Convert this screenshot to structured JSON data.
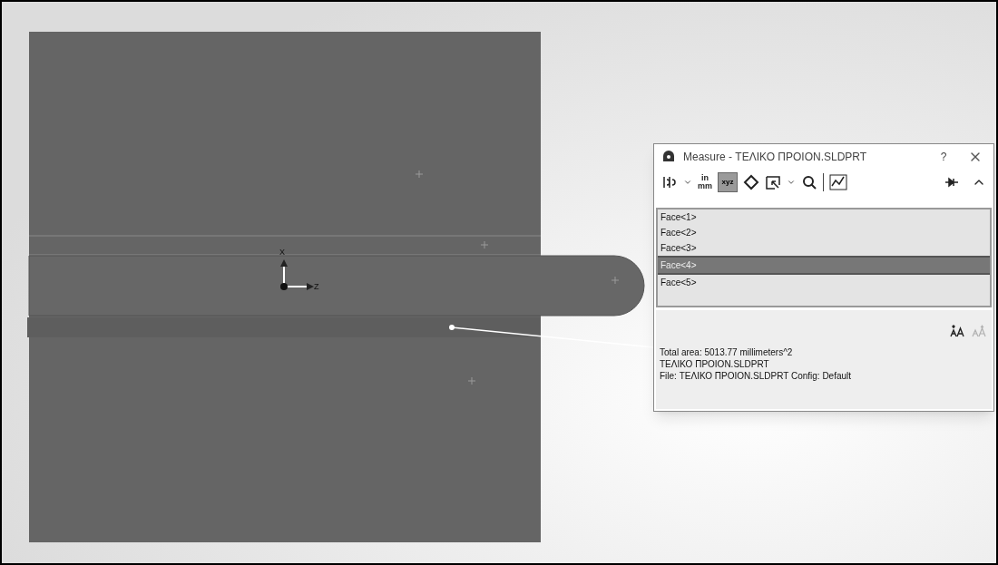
{
  "viewport": {
    "axes": {
      "vertical": "X",
      "horizontal": "Z"
    }
  },
  "dialog": {
    "title": "Measure - ΤΕΛΙΚΟ ΠΡΟΙΟΝ.SLDPRT",
    "help": "?",
    "toolbar": {
      "units": [
        "in",
        "mm"
      ],
      "xyz_labels": [
        "x",
        "y",
        "z"
      ],
      "xyz_selected": true
    },
    "selections": [
      {
        "label": "Face<1>",
        "selected": false
      },
      {
        "label": "Face<2>",
        "selected": false
      },
      {
        "label": "Face<3>",
        "selected": false
      },
      {
        "label": "Face<4>",
        "selected": true
      },
      {
        "label": "Face<5>",
        "selected": false
      }
    ],
    "results": [
      "Total area: 5013.77 millimeters^2",
      "ΤΕΛΙΚΟ ΠΡΟΙΟΝ.SLDPRT",
      "File: ΤΕΛΙΚΟ ΠΡΟΙΟΝ.SLDPRT Config: Default"
    ]
  }
}
